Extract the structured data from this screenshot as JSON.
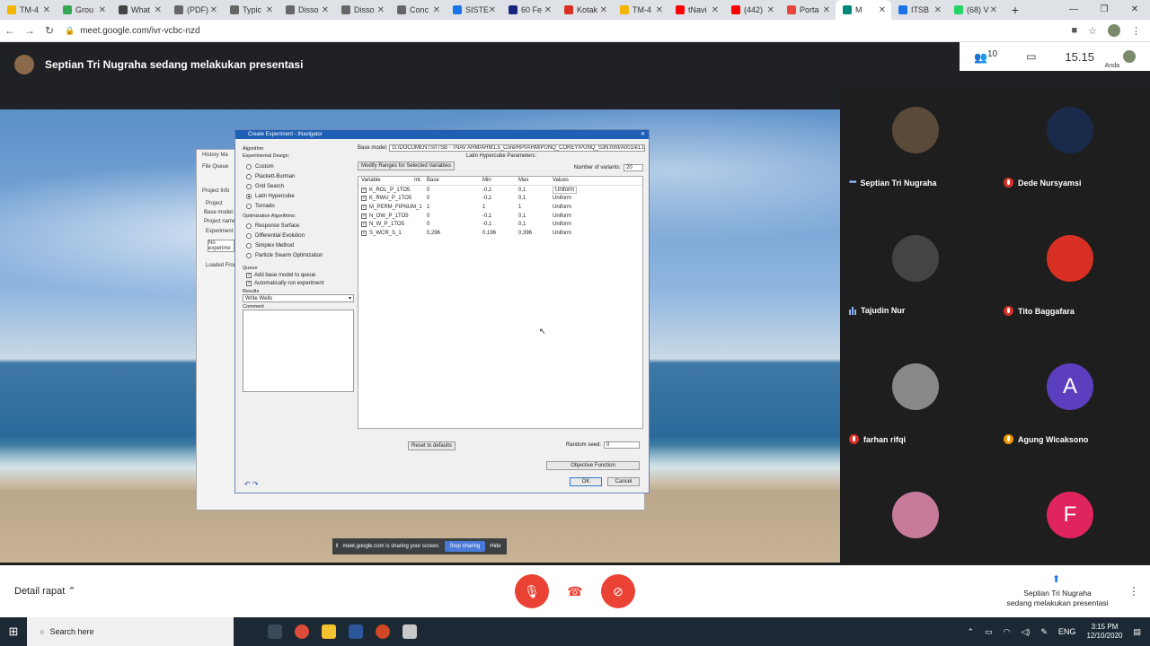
{
  "browser": {
    "tabs": [
      {
        "label": "TM-4",
        "color": "#f4b400"
      },
      {
        "label": "Grou",
        "color": "#34a853"
      },
      {
        "label": "What",
        "color": "#444444"
      },
      {
        "label": "(PDF)",
        "color": "#666666"
      },
      {
        "label": "Typic",
        "color": "#666666"
      },
      {
        "label": "Disso",
        "color": "#666666"
      },
      {
        "label": "Disso",
        "color": "#666666"
      },
      {
        "label": "Conc",
        "color": "#666666"
      },
      {
        "label": "SISTE",
        "color": "#1a73e8"
      },
      {
        "label": "60 Fe",
        "color": "#1a237e"
      },
      {
        "label": "Kotak",
        "color": "#d93025"
      },
      {
        "label": "TM-4",
        "color": "#f4b400"
      },
      {
        "label": "tNavi",
        "color": "#ff0000"
      },
      {
        "label": "(442)",
        "color": "#ff0000"
      },
      {
        "label": "Porta",
        "color": "#e8453c"
      },
      {
        "label": "M",
        "color": "#00897b",
        "active": true
      },
      {
        "label": "ITSB",
        "color": "#1a73e8"
      },
      {
        "label": "(68) V",
        "color": "#25d366"
      }
    ],
    "new_tab": "+",
    "url": "meet.google.com/ivr-vcbc-nzd"
  },
  "meet": {
    "presenter_banner": "Septian Tri Nugraha sedang melakukan presentasi",
    "participant_count": "10",
    "time": "15.15",
    "self_label": "Anda"
  },
  "shared_screen": {
    "history_window": {
      "title": "History Ma",
      "menu": "File   Queue",
      "project_info": "Project Info",
      "project": "Project",
      "base_model": "Base model:",
      "project_name": "Project name:",
      "experiment": "Experiment",
      "no_experiment": "No experime",
      "loaded_from": "Loaded From:"
    },
    "dialog": {
      "title": "Create Experiment - tNavigator",
      "algorithm": "Algorithm",
      "experimental_design": "Experimental Design:",
      "design_options": [
        "Custom",
        "Plackett-Burman",
        "Grid Search",
        "Latin Hypercube",
        "Tornado"
      ],
      "selected_design": "Latin Hypercube",
      "optimization_algorithms": "Optimization Algorithms:",
      "optimization_options": [
        "Response Surface",
        "Differential Evolution",
        "Simplex Method",
        "Particle Swarm Optimization"
      ],
      "queue": "Queue",
      "queue_options": [
        "Add base model to queue",
        "Automatically run experiment"
      ],
      "results": "Results",
      "results_value": "Write Wells",
      "comment": "Comment",
      "base_model_label": "Base model:",
      "base_model_path": "G:/DOCUMENTS/ITSB - TNAV AHM/AHM1.5_Core/RPI/AHM/PUNQ_COREY/PUNQ_S3N.hmf/A001/e1.DATA",
      "latin_hypercube_params": "Latin Hypercube Parameters:",
      "modify_ranges": "Modify Ranges for Selected Variables",
      "number_of_variants": "Number of variants:",
      "variants_value": "20",
      "columns": [
        "Variable",
        "Int.",
        "Base",
        "Min",
        "Max",
        "Values"
      ],
      "rows": [
        {
          "variable": "K_ROL_P_1TO5",
          "base": "0",
          "min": "-0,1",
          "max": "0,1",
          "values": "Uniform"
        },
        {
          "variable": "K_RWU_P_1TO5",
          "base": "0",
          "min": "-0,1",
          "max": "0,1",
          "values": "Uniform"
        },
        {
          "variable": "M_PERM_FIPNUM_1",
          "base": "1",
          "min": "1",
          "max": "1",
          "values": "Uniform"
        },
        {
          "variable": "N_OW_P_1TO5",
          "base": "0",
          "min": "-0,1",
          "max": "0,1",
          "values": "Uniform"
        },
        {
          "variable": "N_W_P_1TO5",
          "base": "0",
          "min": "-0,1",
          "max": "0,1",
          "values": "Uniform"
        },
        {
          "variable": "S_WCR_S_1",
          "base": "0,296",
          "min": "0,196",
          "max": "0,396",
          "values": "Uniform"
        }
      ],
      "reset_defaults": "Reset to defaults",
      "random_seed": "Random seed:",
      "random_seed_value": "0",
      "objective_function": "Objective Function",
      "ok": "OK",
      "cancel": "Cancel"
    },
    "sharing_bar": {
      "text": "meet.google.com is sharing your screen.",
      "stop": "Stop sharing",
      "hide": "Hide"
    }
  },
  "participants": [
    {
      "name": "Septian Tri Nugraha",
      "muted": false,
      "indicator": "dots",
      "avatar_color": "#5a4a3a",
      "initial": ""
    },
    {
      "name": "Dede Nursyamsi",
      "muted": true,
      "indicator": "mic",
      "avatar_color": "#1a2a4a",
      "initial": ""
    },
    {
      "name": "Tajudin Nur",
      "muted": false,
      "indicator": "bars",
      "avatar_color": "#444444",
      "initial": ""
    },
    {
      "name": "Tito Baggafara",
      "muted": true,
      "indicator": "mic",
      "avatar_color": "#d93025",
      "initial": ""
    },
    {
      "name": "farhan rifqi",
      "muted": true,
      "indicator": "mic",
      "avatar_color": "#888888",
      "initial": ""
    },
    {
      "name": "Agung Wicaksono",
      "muted": false,
      "indicator": "mic-orange",
      "avatar_color": "#5c3fbf",
      "initial": "A"
    },
    {
      "name": "",
      "muted": false,
      "indicator": "",
      "avatar_color": "#c87a9a",
      "initial": ""
    },
    {
      "name": "",
      "muted": false,
      "indicator": "",
      "avatar_color": "#e0245e",
      "initial": "F"
    }
  ],
  "controls": {
    "meeting_details": "Detail rapat",
    "presenting_line1": "Septian Tri Nugraha",
    "presenting_line2": "sedang melakukan presentasi",
    "mic_color": "#ea4335",
    "end_color": "#ea4335",
    "cam_color": "#ea4335"
  },
  "taskbar": {
    "search_placeholder": "Search here",
    "lang": "ENG",
    "time": "3:15 PM",
    "date": "12/10/2020"
  }
}
